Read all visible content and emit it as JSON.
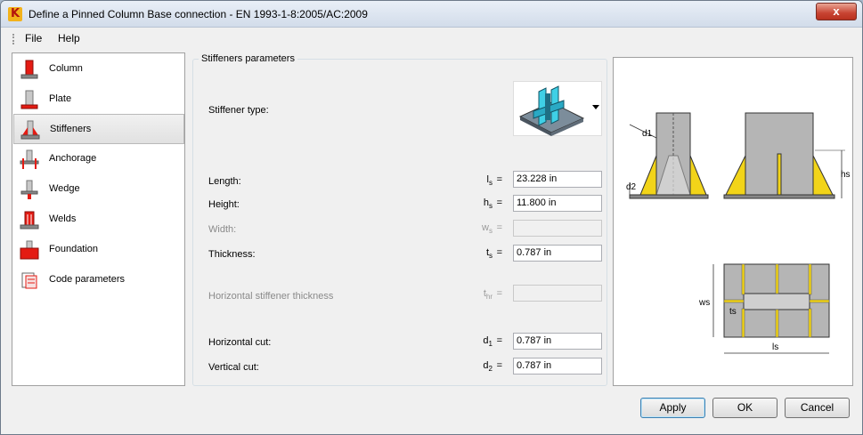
{
  "window": {
    "title": "Define a Pinned Column Base connection - EN 1993-1-8:2005/AC:2009",
    "close_glyph": "x"
  },
  "menu": {
    "file": "File",
    "help": "Help"
  },
  "sidebar": {
    "items": [
      {
        "label": "Column",
        "icon": "column-icon"
      },
      {
        "label": "Plate",
        "icon": "plate-icon"
      },
      {
        "label": "Stiffeners",
        "icon": "stiffeners-icon",
        "selected": true
      },
      {
        "label": "Anchorage",
        "icon": "anchorage-icon"
      },
      {
        "label": "Wedge",
        "icon": "wedge-icon"
      },
      {
        "label": "Welds",
        "icon": "welds-icon"
      },
      {
        "label": "Foundation",
        "icon": "foundation-icon"
      },
      {
        "label": "Code parameters",
        "icon": "code-parameters-icon"
      }
    ]
  },
  "group": {
    "title": "Stiffeners parameters"
  },
  "params": {
    "stiffener_type_label": "Stiffener type:",
    "length": {
      "label": "Length:",
      "sym": "l",
      "sub": "s",
      "value": "23.228 in"
    },
    "height": {
      "label": "Height:",
      "sym": "h",
      "sub": "s",
      "value": "11.800 in"
    },
    "width": {
      "label": "Width:",
      "sym": "w",
      "sub": "s",
      "value": ""
    },
    "thickness": {
      "label": "Thickness:",
      "sym": "t",
      "sub": "s",
      "value": "0.787 in"
    },
    "hthick": {
      "label": "Horizontal stiffener thickness",
      "sym": "t",
      "sub": "hr",
      "value": ""
    },
    "hcut": {
      "label": "Horizontal cut:",
      "sym": "d",
      "sub": "1",
      "value": "0.787 in"
    },
    "vcut": {
      "label": "Vertical cut:",
      "sym": "d",
      "sub": "2",
      "value": "0.787 in"
    },
    "eq": "="
  },
  "diagram": {
    "d1": "d1",
    "d2": "d2",
    "hs": "hs",
    "ws": "ws",
    "ts": "ts",
    "ls": "ls"
  },
  "buttons": {
    "apply": "Apply",
    "ok": "OK",
    "cancel": "Cancel"
  },
  "colors": {
    "accent_red": "#e41b13",
    "stiffener_yellow": "#f2d419",
    "steel_gray": "#b5b5b5",
    "cyan_plate": "#3fd0e6"
  }
}
